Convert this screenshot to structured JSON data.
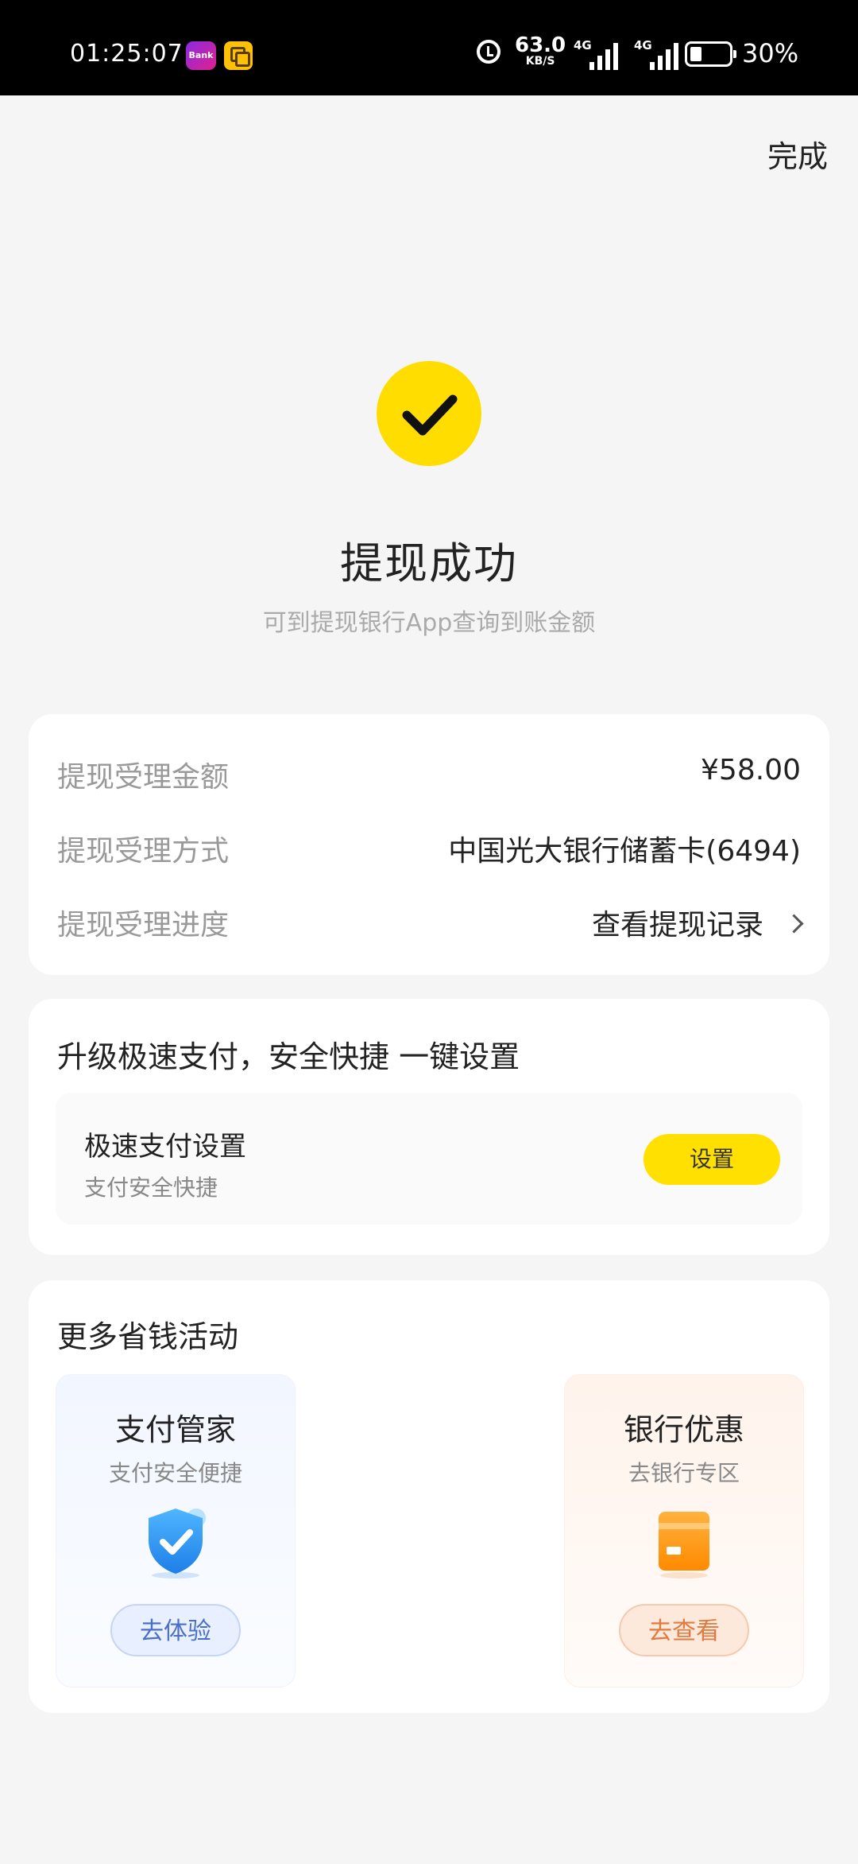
{
  "status_bar": {
    "time": "01:25:07",
    "app_icon_1_text": "Bank",
    "net_speed_value": "63.0",
    "net_speed_unit": "KB/S",
    "net1_label": "4G",
    "net2_label": "4G",
    "battery_percent": "30%"
  },
  "header": {
    "done_label": "完成"
  },
  "success": {
    "title": "提现成功",
    "subtitle": "可到提现银行App查询到账金额",
    "accent_color": "#ffdd00"
  },
  "details": {
    "rows": [
      {
        "label": "提现受理金额",
        "value": "¥58.00"
      },
      {
        "label": "提现受理方式",
        "value": "中国光大银行储蓄卡(6494)"
      },
      {
        "label": "提现受理进度",
        "value": "查看提现记录"
      }
    ]
  },
  "fast_pay": {
    "heading": "升级极速支付，安全快捷 一键设置",
    "item_title": "极速支付设置",
    "item_subtitle": "支付安全快捷",
    "button_label": "设置"
  },
  "more": {
    "heading": "更多省钱活动",
    "cards": [
      {
        "title": "支付管家",
        "subtitle": "支付安全便捷",
        "button": "去体验",
        "icon": "shield-check-icon"
      },
      {
        "title": "银行优惠",
        "subtitle": "去银行专区",
        "button": "去查看",
        "icon": "bank-card-icon"
      }
    ]
  }
}
